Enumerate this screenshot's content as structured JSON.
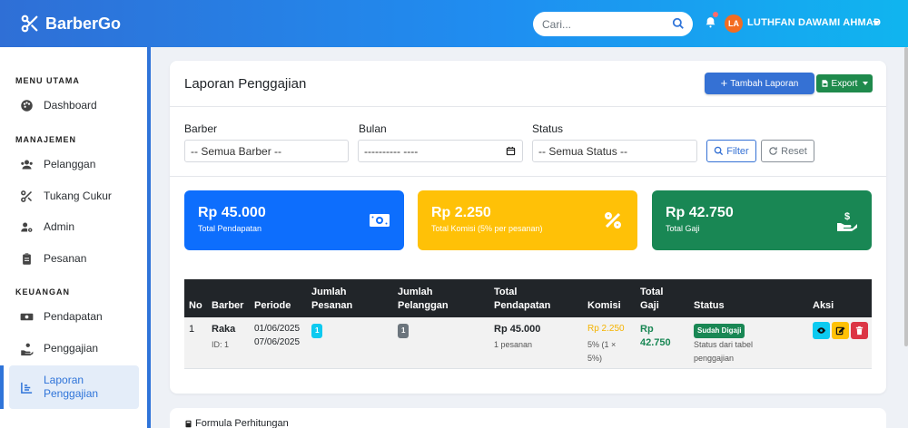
{
  "brand": {
    "name": "BarberGo"
  },
  "search": {
    "placeholder": "Cari..."
  },
  "user": {
    "initials": "LA",
    "name": "LUTHFAN DAWAMI AHMAD"
  },
  "sidebar": {
    "sections": [
      "MENU UTAMA",
      "MANAJEMEN",
      "KEUANGAN"
    ],
    "items": [
      {
        "label": "Dashboard",
        "icon": "palette-icon"
      },
      {
        "label": "Pelanggan",
        "icon": "users-icon"
      },
      {
        "label": "Tukang Cukur",
        "icon": "scissors-icon"
      },
      {
        "label": "Admin",
        "icon": "user-cog-icon"
      },
      {
        "label": "Pesanan",
        "icon": "clipboard-icon"
      },
      {
        "label": "Pendapatan",
        "icon": "money-icon"
      },
      {
        "label": "Penggajian",
        "icon": "hand-coin-icon"
      },
      {
        "label": "Laporan Penggajian",
        "icon": "chart-icon",
        "active": true
      }
    ]
  },
  "page": {
    "title": "Laporan Penggajian",
    "add_label": "Tambah Laporan",
    "export_label": "Export"
  },
  "filters": {
    "barber_label": "Barber",
    "barber_value": "-- Semua Barber --",
    "bulan_label": "Bulan",
    "bulan_value": "---------- ----",
    "status_label": "Status",
    "status_value": "-- Semua Status --",
    "filter_label": "Filter",
    "reset_label": "Reset"
  },
  "stats": [
    {
      "value": "Rp 45.000",
      "label": "Total Pendapatan",
      "color": "#0d6efd",
      "icon": "money-bill-icon"
    },
    {
      "value": "Rp 2.250",
      "label": "Total Komisi (5% per pesanan)",
      "color": "#ffc107",
      "icon": "percent-icon"
    },
    {
      "value": "Rp 42.750",
      "label": "Total Gaji",
      "color": "#198754",
      "icon": "hand-dollar-icon"
    }
  ],
  "table": {
    "headers": {
      "no": "No",
      "barber": "Barber",
      "periode": "Periode",
      "jumlah_pesanan_1": "Jumlah",
      "jumlah_pesanan_2": "Pesanan",
      "jumlah_pelanggan_1": "Jumlah",
      "jumlah_pelanggan_2": "Pelanggan",
      "total_pendapatan_1": "Total",
      "total_pendapatan_2": "Pendapatan",
      "komisi": "Komisi",
      "total_gaji_1": "Total",
      "total_gaji_2": "Gaji",
      "status": "Status",
      "aksi": "Aksi"
    },
    "rows": [
      {
        "no": "1",
        "barber_name": "Raka",
        "barber_id": "ID: 1",
        "periode_start": "01/06/2025",
        "periode_end": "07/06/2025",
        "jumlah_pesanan": "1",
        "jumlah_pelanggan": "1",
        "total_pendapatan": "Rp 45.000",
        "pesanan_count": "1 pesanan",
        "komisi_value": "Rp 2.250",
        "komisi_note_1": "5% (1 ×",
        "komisi_note_2": "5%)",
        "gaji_1": "Rp",
        "gaji_2": "42.750",
        "status_badge": "Sudah Digaji",
        "status_note_1": "Status dari tabel",
        "status_note_2": "penggajian"
      }
    ]
  },
  "formula": {
    "title": "Formula Perhitungan"
  },
  "colors": {
    "primary": "#3571d4",
    "success": "#198754",
    "warning": "#ffc107",
    "info": "#0dcaf0",
    "danger": "#dc3545"
  }
}
